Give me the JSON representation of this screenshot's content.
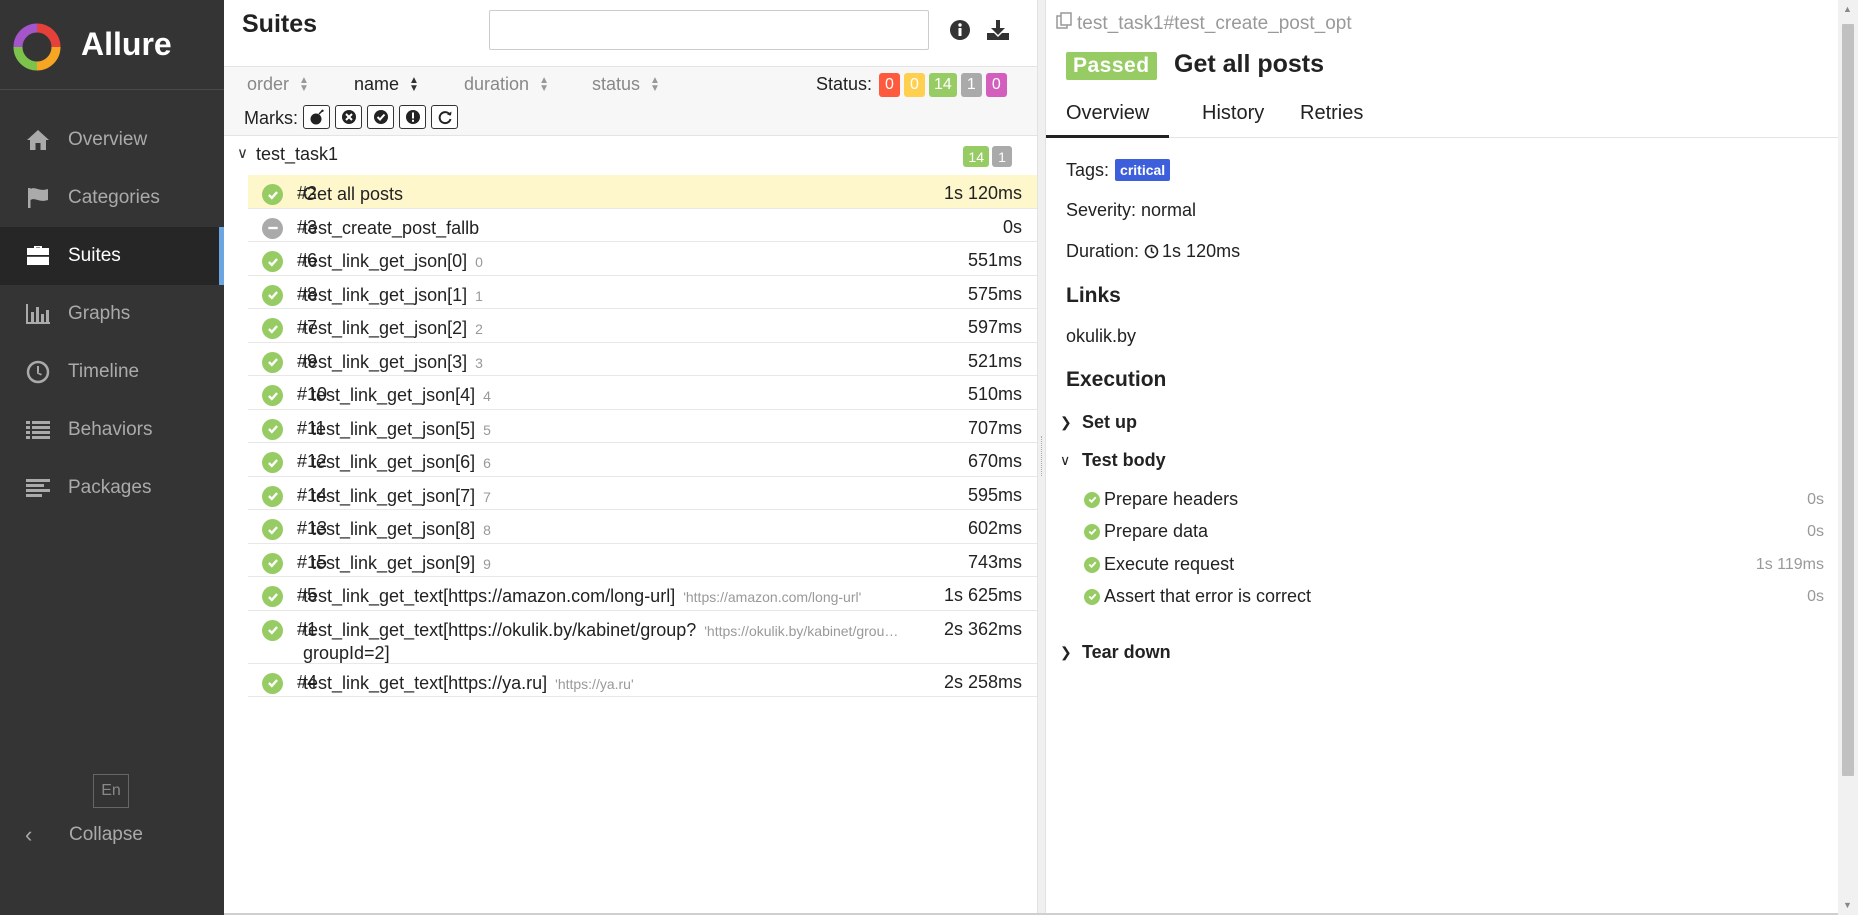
{
  "brand": {
    "name": "Allure"
  },
  "sidebar": {
    "items": [
      {
        "label": "Overview",
        "icon": "home-icon",
        "active": false
      },
      {
        "label": "Categories",
        "icon": "flag-icon",
        "active": false
      },
      {
        "label": "Suites",
        "icon": "briefcase-icon",
        "active": true
      },
      {
        "label": "Graphs",
        "icon": "bar-chart-icon",
        "active": false
      },
      {
        "label": "Timeline",
        "icon": "clock-icon",
        "active": false
      },
      {
        "label": "Behaviors",
        "icon": "list-icon",
        "active": false
      },
      {
        "label": "Packages",
        "icon": "align-left-icon",
        "active": false
      }
    ],
    "language": "En",
    "collapse": "Collapse"
  },
  "suites": {
    "title": "Suites",
    "search": {
      "value": "",
      "placeholder": ""
    },
    "sort": {
      "order": "order",
      "name": "name",
      "duration": "duration",
      "status": "status",
      "selected": "name"
    },
    "status_label": "Status:",
    "status_counts": [
      {
        "value": "0",
        "color": "#fd5a3e",
        "kind": "failed"
      },
      {
        "value": "0",
        "color": "#ffd050",
        "kind": "broken"
      },
      {
        "value": "14",
        "color": "#97cc64",
        "kind": "passed"
      },
      {
        "value": "1",
        "color": "#aaaaaa",
        "kind": "skipped"
      },
      {
        "value": "0",
        "color": "#d35ebe",
        "kind": "unknown"
      }
    ],
    "marks_label": "Marks:",
    "marks": [
      "flaky-bomb-icon",
      "new-failed-icon",
      "new-passed-icon",
      "new-broken-icon",
      "retries-icon"
    ],
    "group": {
      "name": "test_task1",
      "counts": [
        {
          "value": "14",
          "color": "#97cc64"
        },
        {
          "value": "1",
          "color": "#aaaaaa"
        }
      ]
    },
    "rows": [
      {
        "num": "#2",
        "name": "Get all posts",
        "param": "",
        "duration": "1s 120ms",
        "status": "passed",
        "selected": true
      },
      {
        "num": "#3",
        "name": "test_create_post_fallb",
        "param": "",
        "duration": "0s",
        "status": "skipped",
        "selected": false
      },
      {
        "num": "#6",
        "name": "test_link_get_json[0]",
        "param": "0",
        "duration": "551ms",
        "status": "passed",
        "selected": false
      },
      {
        "num": "#8",
        "name": "test_link_get_json[1]",
        "param": "1",
        "duration": "575ms",
        "status": "passed",
        "selected": false
      },
      {
        "num": "#7",
        "name": "test_link_get_json[2]",
        "param": "2",
        "duration": "597ms",
        "status": "passed",
        "selected": false
      },
      {
        "num": "#9",
        "name": "test_link_get_json[3]",
        "param": "3",
        "duration": "521ms",
        "status": "passed",
        "selected": false
      },
      {
        "num": "#10",
        "name": "test_link_get_json[4]",
        "param": "4",
        "duration": "510ms",
        "status": "passed",
        "selected": false
      },
      {
        "num": "#11",
        "name": "test_link_get_json[5]",
        "param": "5",
        "duration": "707ms",
        "status": "passed",
        "selected": false
      },
      {
        "num": "#12",
        "name": "test_link_get_json[6]",
        "param": "6",
        "duration": "670ms",
        "status": "passed",
        "selected": false
      },
      {
        "num": "#14",
        "name": "test_link_get_json[7]",
        "param": "7",
        "duration": "595ms",
        "status": "passed",
        "selected": false
      },
      {
        "num": "#13",
        "name": "test_link_get_json[8]",
        "param": "8",
        "duration": "602ms",
        "status": "passed",
        "selected": false
      },
      {
        "num": "#15",
        "name": "test_link_get_json[9]",
        "param": "9",
        "duration": "743ms",
        "status": "passed",
        "selected": false
      },
      {
        "num": "#5",
        "name": "test_link_get_text[https://amazon.com/long-url]",
        "param": "'https://amazon.com/long-url'",
        "duration": "1s 625ms",
        "status": "passed",
        "selected": false
      },
      {
        "num": "#1",
        "name": "test_link_get_text[https://okulik.by/kabinet/group?",
        "name2": "groupId=2]",
        "param": "'https://okulik.by/kabinet/grou…",
        "duration": "2s 362ms",
        "status": "passed",
        "selected": false
      },
      {
        "num": "#4",
        "name": "test_link_get_text[https://ya.ru]",
        "param": "'https://ya.ru'",
        "duration": "2s 258ms",
        "status": "passed",
        "selected": false
      }
    ]
  },
  "detail": {
    "breadcrumb": "test_task1#test_create_post_opt",
    "status": "Passed",
    "status_color": "#97cc64",
    "title": "Get all posts",
    "tabs": [
      "Overview",
      "History",
      "Retries"
    ],
    "tags_label": "Tags:",
    "tag": "critical",
    "severity": "Severity: normal",
    "duration_label": "Duration:",
    "duration": "1s 120ms",
    "links_heading": "Links",
    "link": "okulik.by",
    "execution_heading": "Execution",
    "setup": "Set up",
    "test_body": "Test body",
    "steps": [
      {
        "name": "Prepare headers",
        "duration": "0s"
      },
      {
        "name": "Prepare data",
        "duration": "0s"
      },
      {
        "name": "Execute request",
        "duration": "1s 119ms"
      },
      {
        "name": "Assert that error is correct",
        "duration": "0s"
      }
    ],
    "teardown": "Tear down"
  }
}
